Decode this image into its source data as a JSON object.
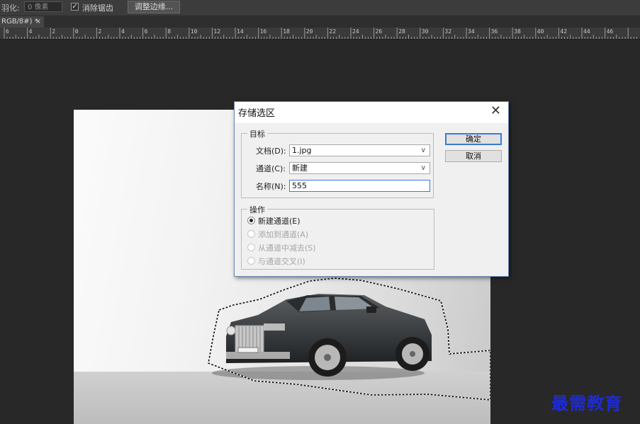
{
  "options_bar": {
    "feather_label": "羽化:",
    "feather_value": "0 像素",
    "antialias_label": "消除锯齿",
    "refine_button": "调整边缘..."
  },
  "document_tab": {
    "label": "RGB/8#) *",
    "close": "×"
  },
  "ruler": {
    "numbers": [
      "6",
      "4",
      "2",
      "0",
      "2",
      "4",
      "6",
      "8",
      "10",
      "12",
      "14",
      "16",
      "18",
      "20",
      "22",
      "24",
      "26",
      "28",
      "30",
      "32",
      "34",
      "36",
      "38",
      "40",
      "42",
      "44",
      "46"
    ]
  },
  "dialog": {
    "title": "存储选区",
    "close": "✕",
    "target_group": "目标",
    "document_label": "文档(D):",
    "document_value": "1.jpg",
    "channel_label": "通道(C):",
    "channel_value": "新建",
    "name_label": "名称(N):",
    "name_value": "555",
    "ok_button": "确定",
    "cancel_button": "取消",
    "operation_group": "操作",
    "operations": [
      {
        "label": "新建通道(E)",
        "selected": true
      },
      {
        "label": "添加到通道(A)",
        "selected": false
      },
      {
        "label": "从通道中减去(S)",
        "selected": false
      },
      {
        "label": "与通道交叉(I)",
        "selected": false
      }
    ]
  },
  "watermark": "最需教育",
  "colors": {
    "arrow": "#e8373a",
    "watermark": "#1d2bd6",
    "dialog_accent": "#3d7ad8"
  }
}
